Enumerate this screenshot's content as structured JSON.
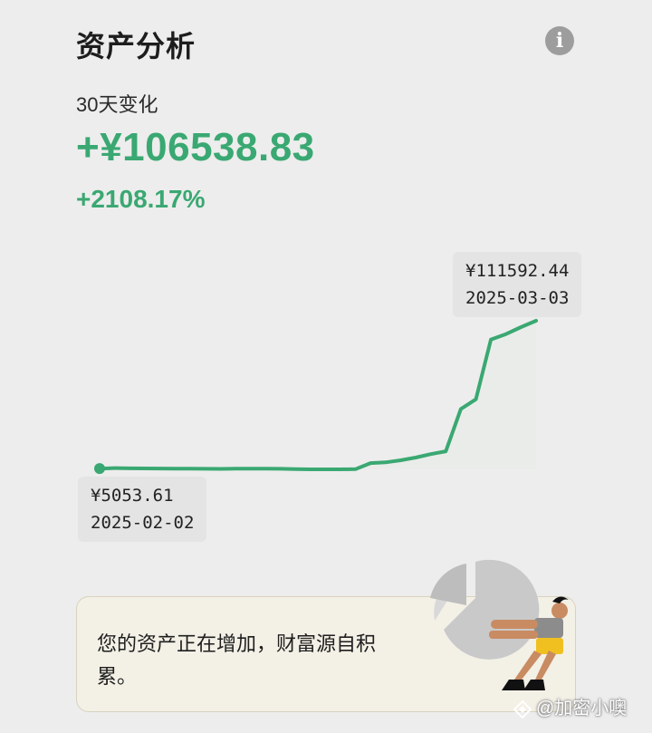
{
  "header": {
    "title": "资产分析",
    "info_icon": "info-icon"
  },
  "summary": {
    "period": "30天变化",
    "change_amount": "+¥106538.83",
    "change_percent": "+2108.17%"
  },
  "colors": {
    "positive": "#3aa872",
    "line": "#3aa872"
  },
  "chart_data": {
    "type": "line",
    "x_start": "2025-02-02",
    "x_end": "2025-03-03",
    "x": [
      "2025-02-02",
      "2025-02-03",
      "2025-02-04",
      "2025-02-05",
      "2025-02-06",
      "2025-02-07",
      "2025-02-08",
      "2025-02-09",
      "2025-02-10",
      "2025-02-11",
      "2025-02-12",
      "2025-02-13",
      "2025-02-14",
      "2025-02-15",
      "2025-02-16",
      "2025-02-17",
      "2025-02-18",
      "2025-02-19",
      "2025-02-20",
      "2025-02-21",
      "2025-02-22",
      "2025-02-23",
      "2025-02-24",
      "2025-02-25",
      "2025-02-26",
      "2025-02-27",
      "2025-02-28",
      "2025-03-01",
      "2025-03-02",
      "2025-03-03"
    ],
    "values": [
      5053.61,
      5400,
      5200,
      5150,
      5100,
      5050,
      5000,
      4900,
      4800,
      4950,
      5050,
      4950,
      4900,
      4600,
      4500,
      4500,
      4500,
      4600,
      9000,
      9500,
      11000,
      13000,
      15500,
      17500,
      48000,
      55000,
      98000,
      102000,
      107000,
      111592.44
    ],
    "points": [
      {
        "label": "max",
        "value_text": "¥111592.44",
        "date": "2025-03-03"
      },
      {
        "label": "min",
        "value_text": "¥5053.61",
        "date": "2025-02-02"
      }
    ]
  },
  "tooltips": {
    "max_value": "¥111592.44",
    "max_date": "2025-03-03",
    "min_value": "¥5053.61",
    "min_date": "2025-02-02"
  },
  "message": {
    "text": "您的资产正在增加，财富源自积累。"
  },
  "watermark": {
    "text": "@加密小噢"
  }
}
